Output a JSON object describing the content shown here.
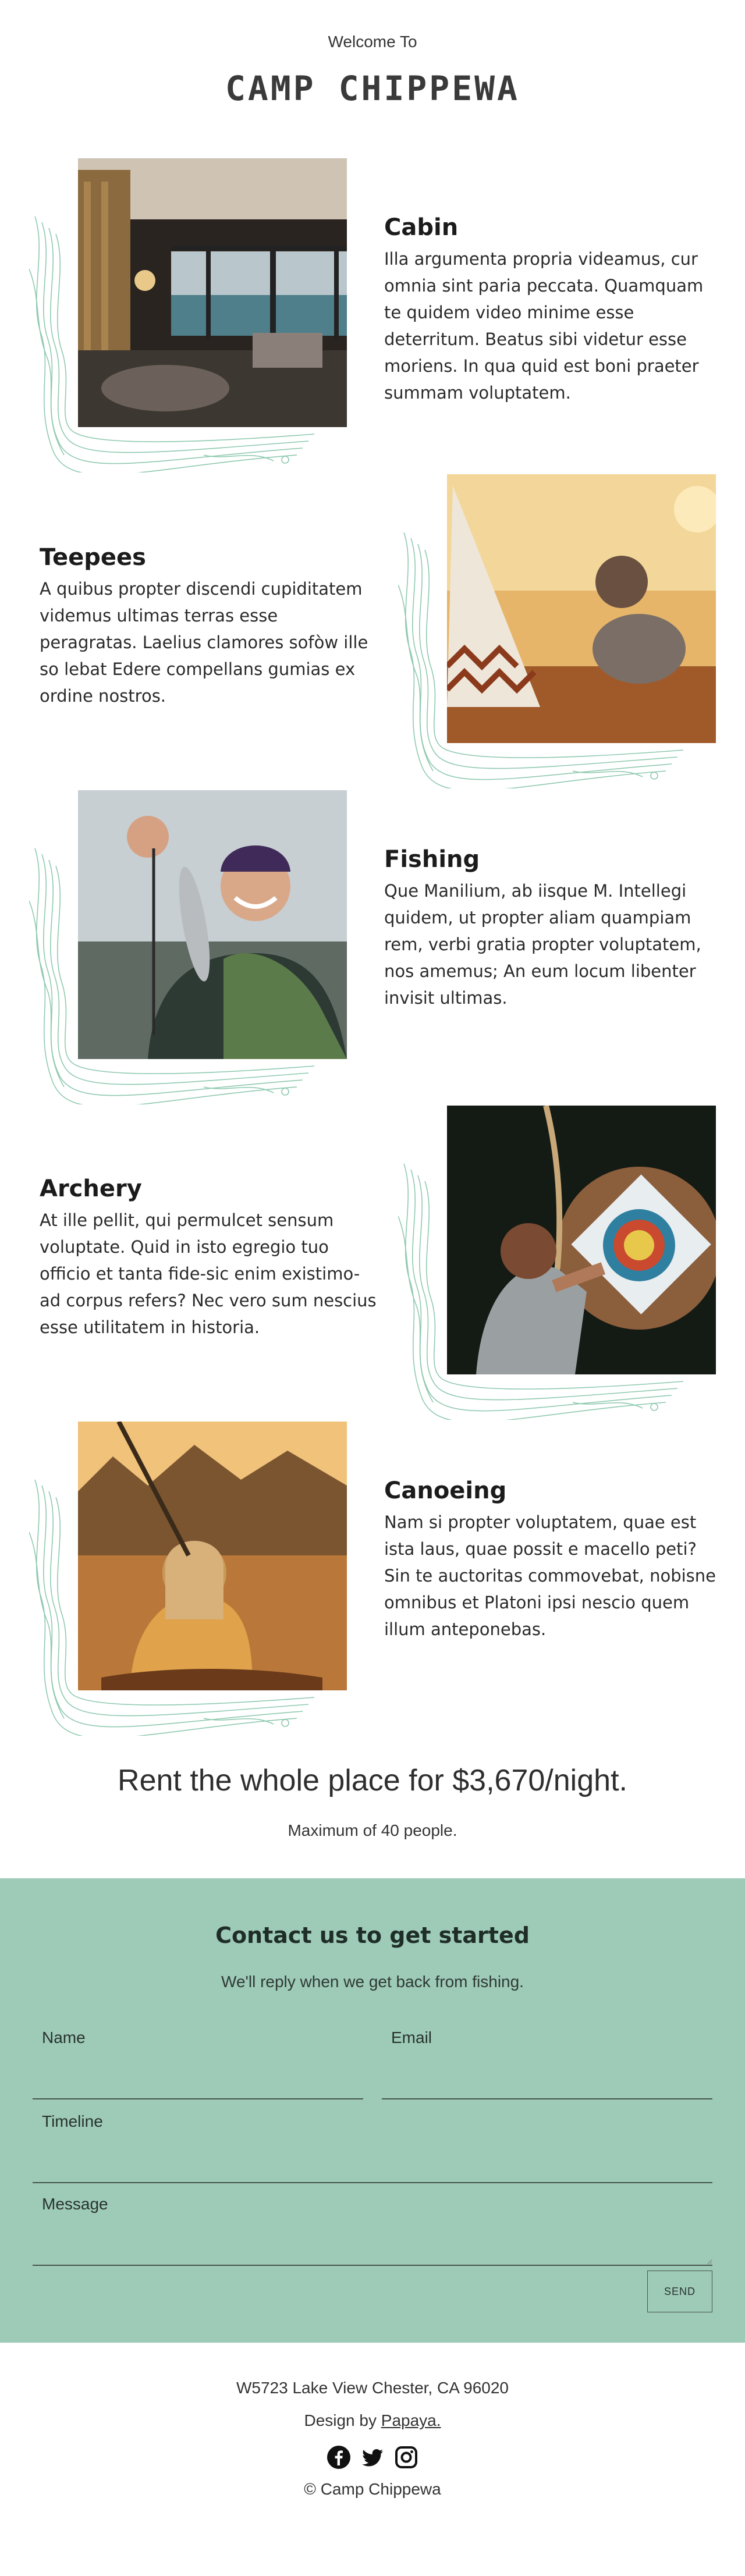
{
  "header": {
    "welcome": "Welcome To",
    "title": "CAMP CHIPPEWA"
  },
  "features": [
    {
      "title": "Cabin",
      "body": "Illa argumenta propria videamus, cur omnia sint paria peccata. Quamquam te quidem video minime esse deterritum. Beatus sibi videtur esse moriens. In qua quid est boni praeter summam voluptatem.",
      "image": "cabin interior with lake view"
    },
    {
      "title": "Teepees",
      "body": "A quibus propter discendi cupiditatem videmus ultimas terras esse peragratas. Laelius clamores sofòw ille so lebat Edere compellans gumias ex ordine nostros.",
      "image": "teepee and child in sunlit forest"
    },
    {
      "title": "Fishing",
      "body": "Que Manilium, ab iisque M. Intellegi quidem, ut propter aliam quampiam rem, verbi gratia propter voluptatem, nos amemus; An eum locum libenter invisit ultimas.",
      "image": "smiling man holding a fish"
    },
    {
      "title": "Archery",
      "body": "At ille pellit, qui permulcet sensum voluptate. Quid in isto egregio tuo officio et tanta fide-sic enim existimo-ad corpus refers? Nec vero sum nescius esse utilitatem in historia.",
      "image": "archer aiming at a target"
    },
    {
      "title": "Canoeing",
      "body": "Nam si propter voluptatem, quae est ista laus, quae possit e macello peti? Sin te auctoritas commovebat, nobisne omnibus et Platoni ipsi nescio quem illum anteponebas.",
      "image": "paddler in canoe on a golden lake"
    }
  ],
  "pricing": {
    "headline": "Rent the whole place for $3,670/night.",
    "note": "Maximum of 40 people."
  },
  "contact": {
    "title": "Contact us to get started",
    "subtitle": "We'll reply when we get back from fishing.",
    "fields": {
      "name": "Name",
      "email": "Email",
      "timeline": "Timeline",
      "message": "Message"
    },
    "send_label": "SEND",
    "background": "#9ecab8"
  },
  "footer": {
    "address": "W5723 Lake View Chester, CA 96020",
    "design_prefix": "Design by",
    "design_link": "Papaya.",
    "social_icons": [
      "facebook-icon",
      "twitter-icon",
      "instagram-icon"
    ],
    "copyright": "© Camp Chippewa"
  },
  "colors": {
    "topo_lines": "#8fc9b0",
    "contact_bg": "#9ecab8"
  }
}
